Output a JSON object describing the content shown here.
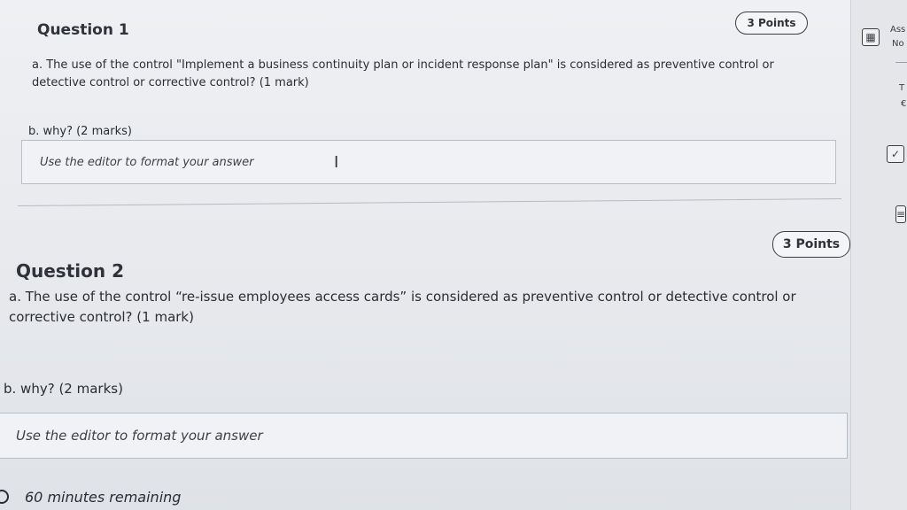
{
  "question1": {
    "title": "Question 1",
    "points": "3 Points",
    "part_a": "a. The use of the control \"Implement a business continuity plan or incident response plan\" is considered as preventive control or detective control or corrective control? (1 mark)",
    "part_b": "b. why? (2 marks)",
    "editor_placeholder": "Use the editor to format your answer"
  },
  "question2": {
    "title": "Question 2",
    "points": "3 Points",
    "part_a": "a. The use of the control “re-issue employees access cards” is considered as preventive control or detective control or corrective control? (1 mark)",
    "part_b": "b. why? (2 marks)",
    "editor_placeholder": "Use the editor to format your answer"
  },
  "rail": {
    "label_1": "Ass",
    "label_2": "No",
    "label_3": "T",
    "label_4": "€"
  },
  "timer": {
    "text": "60 minutes remaining"
  }
}
